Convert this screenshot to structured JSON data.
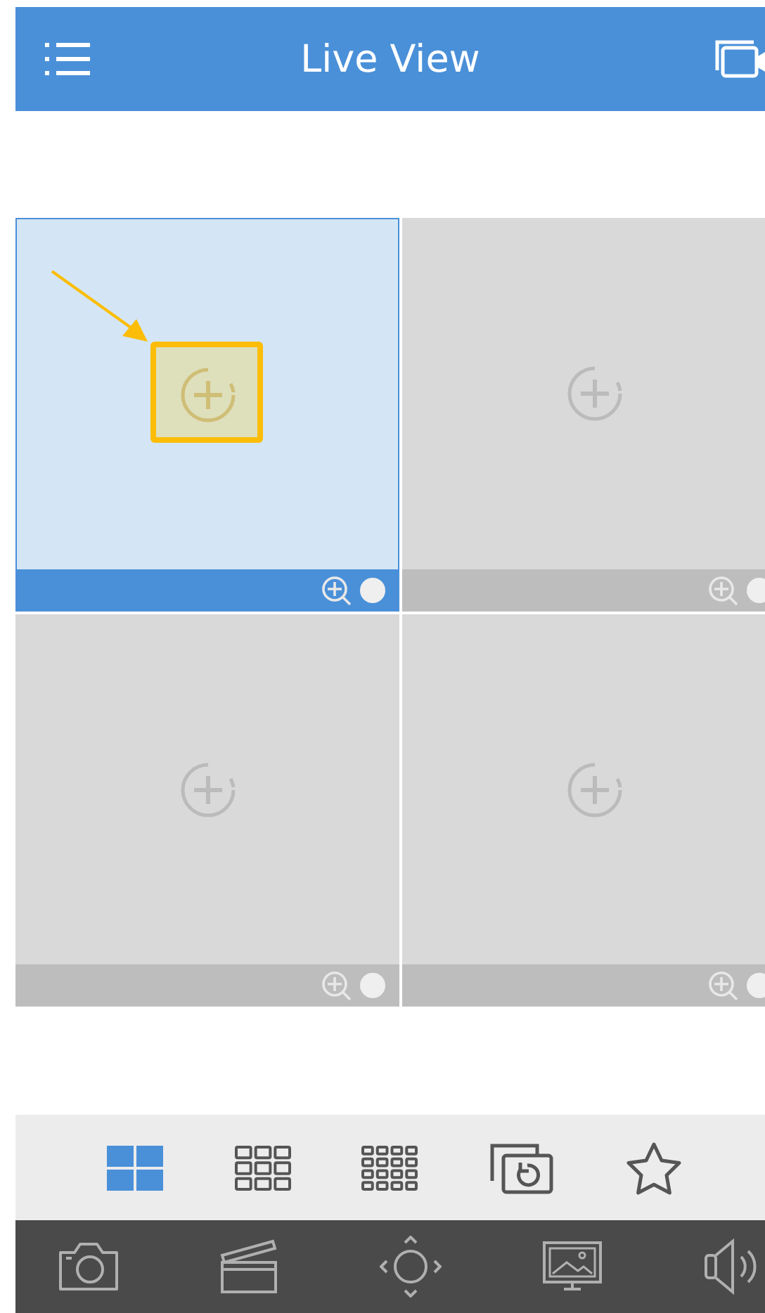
{
  "header": {
    "title": "Live View"
  },
  "tiles": [
    {
      "selected": true,
      "highlighted": true
    },
    {
      "selected": false,
      "highlighted": false
    },
    {
      "selected": false,
      "highlighted": false
    },
    {
      "selected": false,
      "highlighted": false
    }
  ],
  "layout_bar": [
    {
      "kind": "grid2",
      "selected": true
    },
    {
      "kind": "grid3",
      "selected": false
    },
    {
      "kind": "grid4",
      "selected": false
    },
    {
      "kind": "sequence",
      "selected": false
    },
    {
      "kind": "favorite",
      "selected": false
    }
  ],
  "control_bar": [
    {
      "kind": "snapshot"
    },
    {
      "kind": "record"
    },
    {
      "kind": "ptz"
    },
    {
      "kind": "display"
    },
    {
      "kind": "audio"
    }
  ]
}
